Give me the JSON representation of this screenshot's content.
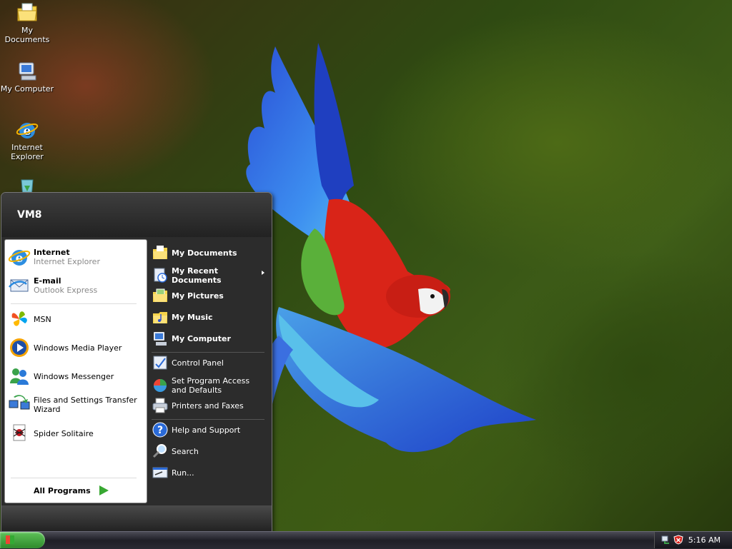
{
  "desktop": {
    "icons": [
      {
        "label": "My Documents",
        "icon": "my-documents-icon"
      },
      {
        "label": "My Computer",
        "icon": "my-computer-icon"
      },
      {
        "label": "Internet Explorer",
        "icon": "internet-explorer-icon"
      },
      {
        "label": "",
        "icon": "recycle-bin-icon"
      }
    ]
  },
  "start_menu": {
    "user_name": "VM8",
    "pinned": [
      {
        "title": "Internet",
        "subtitle": "Internet Explorer",
        "icon": "internet-explorer-icon"
      },
      {
        "title": "E-mail",
        "subtitle": "Outlook Express",
        "icon": "outlook-express-icon"
      }
    ],
    "recent": [
      {
        "label": "MSN",
        "icon": "msn-icon"
      },
      {
        "label": "Windows Media Player",
        "icon": "windows-media-player-icon"
      },
      {
        "label": "Windows Messenger",
        "icon": "windows-messenger-icon"
      },
      {
        "label": "Files and Settings Transfer Wizard",
        "icon": "transfer-wizard-icon"
      },
      {
        "label": "Spider Solitaire",
        "icon": "spider-solitaire-icon"
      }
    ],
    "all_programs": "All Programs",
    "places": [
      {
        "label": "My Documents",
        "icon": "my-documents-icon"
      },
      {
        "label": "My Recent Documents",
        "icon": "recent-documents-icon"
      },
      {
        "label": "My Pictures",
        "icon": "my-pictures-icon"
      },
      {
        "label": "My Music",
        "icon": "my-music-icon"
      },
      {
        "label": "My Computer",
        "icon": "my-computer-icon"
      }
    ],
    "settings": [
      {
        "label": "Control Panel",
        "icon": "control-panel-icon"
      },
      {
        "label": "Set Program Access and Defaults",
        "icon": "program-access-icon"
      },
      {
        "label": "Printers and Faxes",
        "icon": "printer-icon"
      }
    ],
    "help": [
      {
        "label": "Help and Support",
        "icon": "help-icon"
      },
      {
        "label": "Search",
        "icon": "search-icon"
      },
      {
        "label": "Run...",
        "icon": "run-icon"
      }
    ]
  },
  "taskbar": {
    "clock": "5:16 AM",
    "tray_icons": [
      "network-icon",
      "security-alert-icon"
    ]
  }
}
